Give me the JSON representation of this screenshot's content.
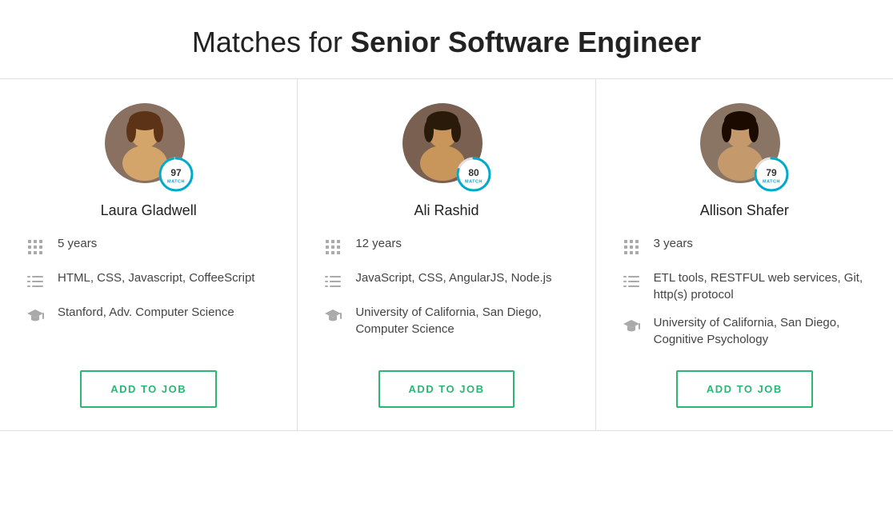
{
  "header": {
    "prefix": "Matches for ",
    "title_bold": "Senior Software Engineer"
  },
  "candidates": [
    {
      "id": "laura",
      "name": "Laura Gladwell",
      "match_score": 97,
      "match_label": "MATCH",
      "match_color": "#00aacc",
      "ring_color": "#00aacc",
      "experience": "5 years",
      "skills": "HTML, CSS, Javascript, CoffeeScript",
      "education": "Stanford, Adv. Computer Science",
      "btn_label": "ADD TO JOB",
      "avatar_color1": "#c9a882",
      "avatar_color2": "#5a3a1a"
    },
    {
      "id": "ali",
      "name": "Ali Rashid",
      "match_score": 80,
      "match_label": "MATCH",
      "match_color": "#00aacc",
      "ring_color": "#00aacc",
      "experience": "12 years",
      "skills": "JavaScript, CSS, AngularJS, Node.js",
      "education": "University of California, San Diego, Computer Science",
      "btn_label": "ADD TO JOB",
      "avatar_color1": "#c4a46b",
      "avatar_color2": "#3a2a1a"
    },
    {
      "id": "allison",
      "name": "Allison Shafer",
      "match_score": 79,
      "match_label": "MATCH",
      "match_color": "#00aacc",
      "ring_color": "#00aacc",
      "experience": "3 years",
      "skills": "ETL tools, RESTFUL web services, Git, http(s) protocol",
      "education": "University of California, San Diego, Cognitive Psychology",
      "btn_label": "ADD TO JOB",
      "avatar_color1": "#b89070",
      "avatar_color2": "#2a1a0a"
    }
  ]
}
